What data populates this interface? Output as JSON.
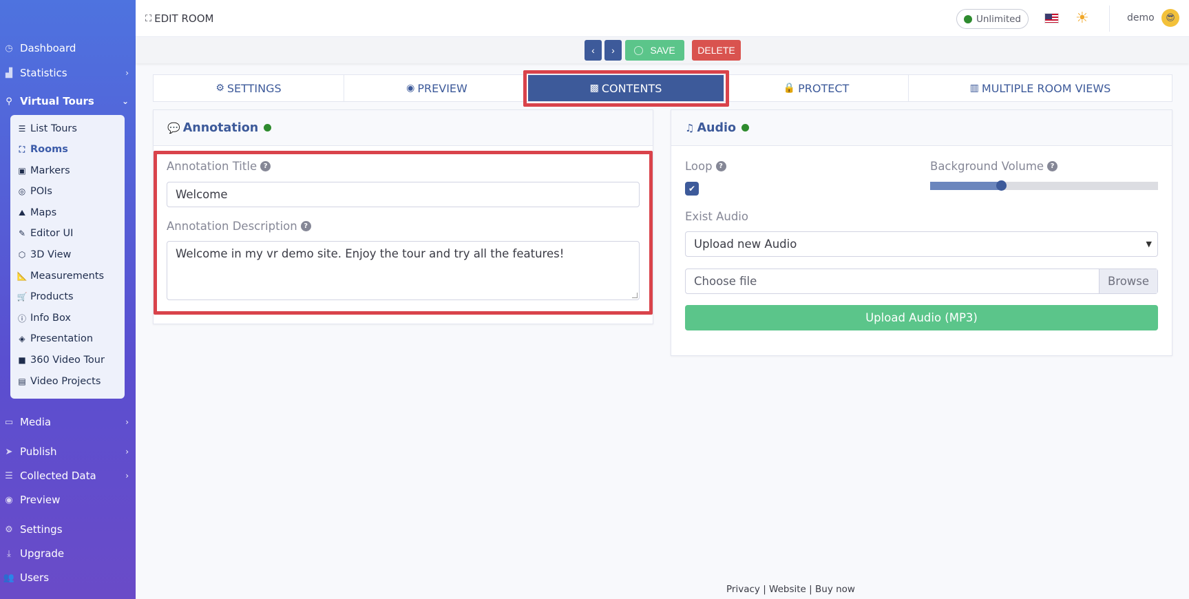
{
  "sidebar": {
    "items": [
      {
        "label": "Dashboard"
      },
      {
        "label": "Statistics"
      },
      {
        "label": "Virtual Tours"
      },
      {
        "label": "Media"
      },
      {
        "label": "Publish"
      },
      {
        "label": "Collected Data"
      },
      {
        "label": "Preview"
      },
      {
        "label": "Settings"
      },
      {
        "label": "Upgrade"
      },
      {
        "label": "Users"
      }
    ],
    "subitems": [
      {
        "label": "List Tours"
      },
      {
        "label": "Rooms"
      },
      {
        "label": "Markers"
      },
      {
        "label": "POIs"
      },
      {
        "label": "Maps"
      },
      {
        "label": "Editor UI"
      },
      {
        "label": "3D View"
      },
      {
        "label": "Measurements"
      },
      {
        "label": "Products"
      },
      {
        "label": "Info Box"
      },
      {
        "label": "Presentation"
      },
      {
        "label": "360 Video Tour"
      },
      {
        "label": "Video Projects"
      }
    ]
  },
  "header": {
    "title": "EDIT ROOM",
    "plan": "Unlimited",
    "username": "demo"
  },
  "actions": {
    "save": "SAVE",
    "delete": "DELETE"
  },
  "tabs": [
    {
      "label": "SETTINGS"
    },
    {
      "label": "PREVIEW"
    },
    {
      "label": "CONTENTS"
    },
    {
      "label": "PROTECT"
    },
    {
      "label": "MULTIPLE ROOM VIEWS"
    }
  ],
  "annotation": {
    "header": "Annotation",
    "title_label": "Annotation Title",
    "title_value": "Welcome",
    "desc_label": "Annotation Description",
    "desc_value": "Welcome in my vr demo site. Enjoy the tour and try all the features!"
  },
  "audio": {
    "header": "Audio",
    "loop_label": "Loop",
    "volume_label": "Background Volume",
    "volume_level": 0.31,
    "exist_label": "Exist Audio",
    "exist_value": "Upload new Audio",
    "file_placeholder": "Choose file",
    "browse": "Browse",
    "upload": "Upload Audio (MP3)"
  },
  "footer": {
    "privacy": "Privacy",
    "website": "Website",
    "buy": "Buy now"
  },
  "colors": {
    "accent": "#3d5a9a",
    "success": "#5bc58a",
    "danger": "#d9534f",
    "highlight": "#d9434b"
  }
}
